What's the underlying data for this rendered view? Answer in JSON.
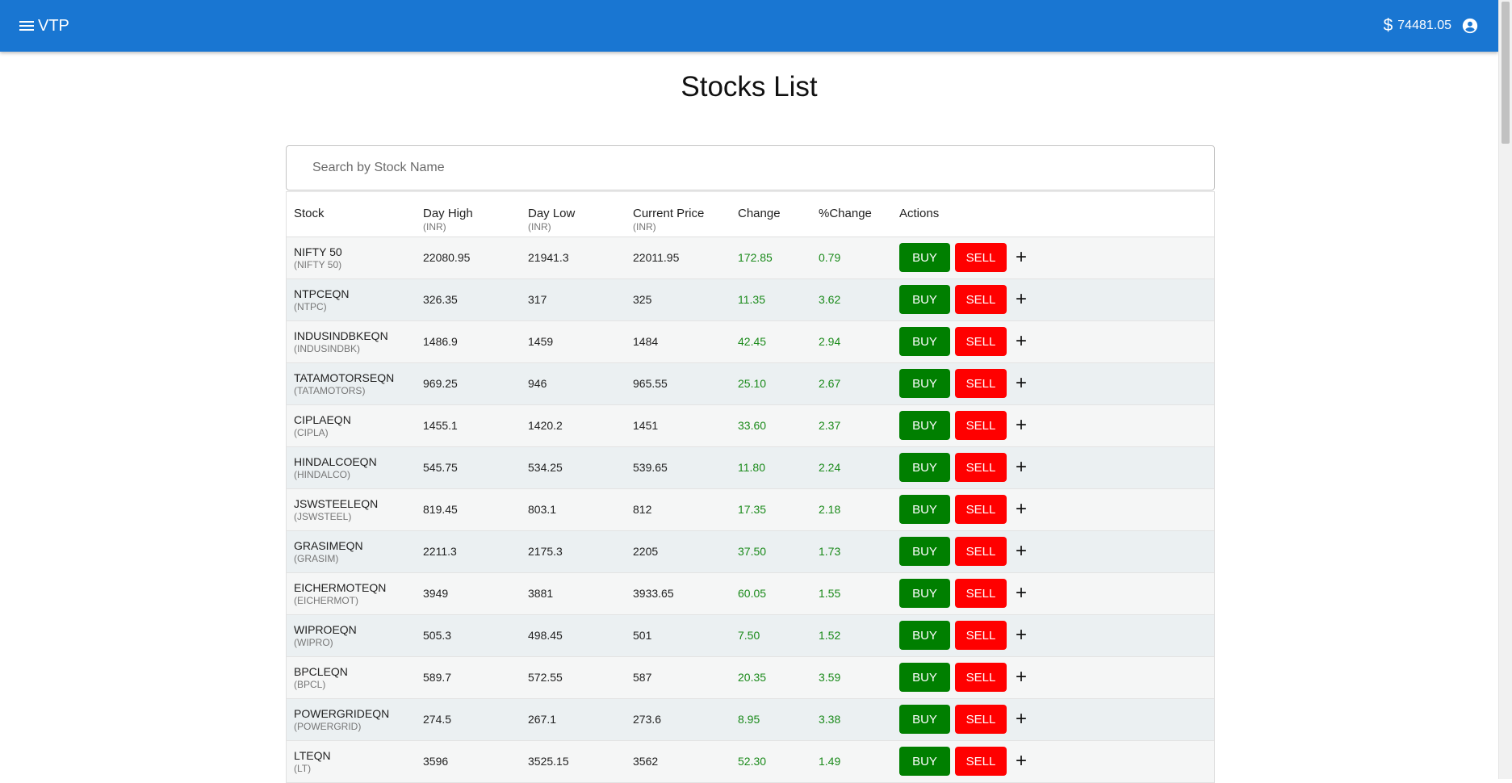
{
  "appbar": {
    "brand": "VTP",
    "balance": "74481.05",
    "currency_icon": "dollar-icon",
    "avatar_icon": "account-circle-icon"
  },
  "page": {
    "title": "Stocks List"
  },
  "search": {
    "placeholder": "Search by Stock Name",
    "value": ""
  },
  "table": {
    "headers": [
      {
        "label": "Stock",
        "sub": ""
      },
      {
        "label": "Day High",
        "sub": "(INR)"
      },
      {
        "label": "Day Low",
        "sub": "(INR)"
      },
      {
        "label": "Current Price",
        "sub": "(INR)"
      },
      {
        "label": "Change",
        "sub": ""
      },
      {
        "label": "%Change",
        "sub": ""
      },
      {
        "label": "Actions",
        "sub": ""
      }
    ],
    "buy_label": "BUY",
    "sell_label": "SELL",
    "add_label": "+",
    "rows": [
      {
        "symbol": "NIFTY 50",
        "name": "(NIFTY 50)",
        "high": "22080.95",
        "low": "21941.3",
        "price": "22011.95",
        "change": "172.85",
        "pct": "0.79"
      },
      {
        "symbol": "NTPCEQN",
        "name": "(NTPC)",
        "high": "326.35",
        "low": "317",
        "price": "325",
        "change": "11.35",
        "pct": "3.62"
      },
      {
        "symbol": "INDUSINDBKEQN",
        "name": "(INDUSINDBK)",
        "high": "1486.9",
        "low": "1459",
        "price": "1484",
        "change": "42.45",
        "pct": "2.94"
      },
      {
        "symbol": "TATAMOTORSEQN",
        "name": "(TATAMOTORS)",
        "high": "969.25",
        "low": "946",
        "price": "965.55",
        "change": "25.10",
        "pct": "2.67"
      },
      {
        "symbol": "CIPLAEQN",
        "name": "(CIPLA)",
        "high": "1455.1",
        "low": "1420.2",
        "price": "1451",
        "change": "33.60",
        "pct": "2.37"
      },
      {
        "symbol": "HINDALCOEQN",
        "name": "(HINDALCO)",
        "high": "545.75",
        "low": "534.25",
        "price": "539.65",
        "change": "11.80",
        "pct": "2.24"
      },
      {
        "symbol": "JSWSTEELEQN",
        "name": "(JSWSTEEL)",
        "high": "819.45",
        "low": "803.1",
        "price": "812",
        "change": "17.35",
        "pct": "2.18"
      },
      {
        "symbol": "GRASIMEQN",
        "name": "(GRASIM)",
        "high": "2211.3",
        "low": "2175.3",
        "price": "2205",
        "change": "37.50",
        "pct": "1.73"
      },
      {
        "symbol": "EICHERMOTEQN",
        "name": "(EICHERMOT)",
        "high": "3949",
        "low": "3881",
        "price": "3933.65",
        "change": "60.05",
        "pct": "1.55"
      },
      {
        "symbol": "WIPROEQN",
        "name": "(WIPRO)",
        "high": "505.3",
        "low": "498.45",
        "price": "501",
        "change": "7.50",
        "pct": "1.52"
      },
      {
        "symbol": "BPCLEQN",
        "name": "(BPCL)",
        "high": "589.7",
        "low": "572.55",
        "price": "587",
        "change": "20.35",
        "pct": "3.59"
      },
      {
        "symbol": "POWERGRIDEQN",
        "name": "(POWERGRID)",
        "high": "274.5",
        "low": "267.1",
        "price": "273.6",
        "change": "8.95",
        "pct": "3.38"
      },
      {
        "symbol": "LTEQN",
        "name": "(LT)",
        "high": "3596",
        "low": "3525.15",
        "price": "3562",
        "change": "52.30",
        "pct": "1.49"
      }
    ]
  },
  "colors": {
    "appbar": "#1976d2",
    "buy": "#007f00",
    "sell": "#ff0000",
    "positive": "#1a8a1a"
  }
}
